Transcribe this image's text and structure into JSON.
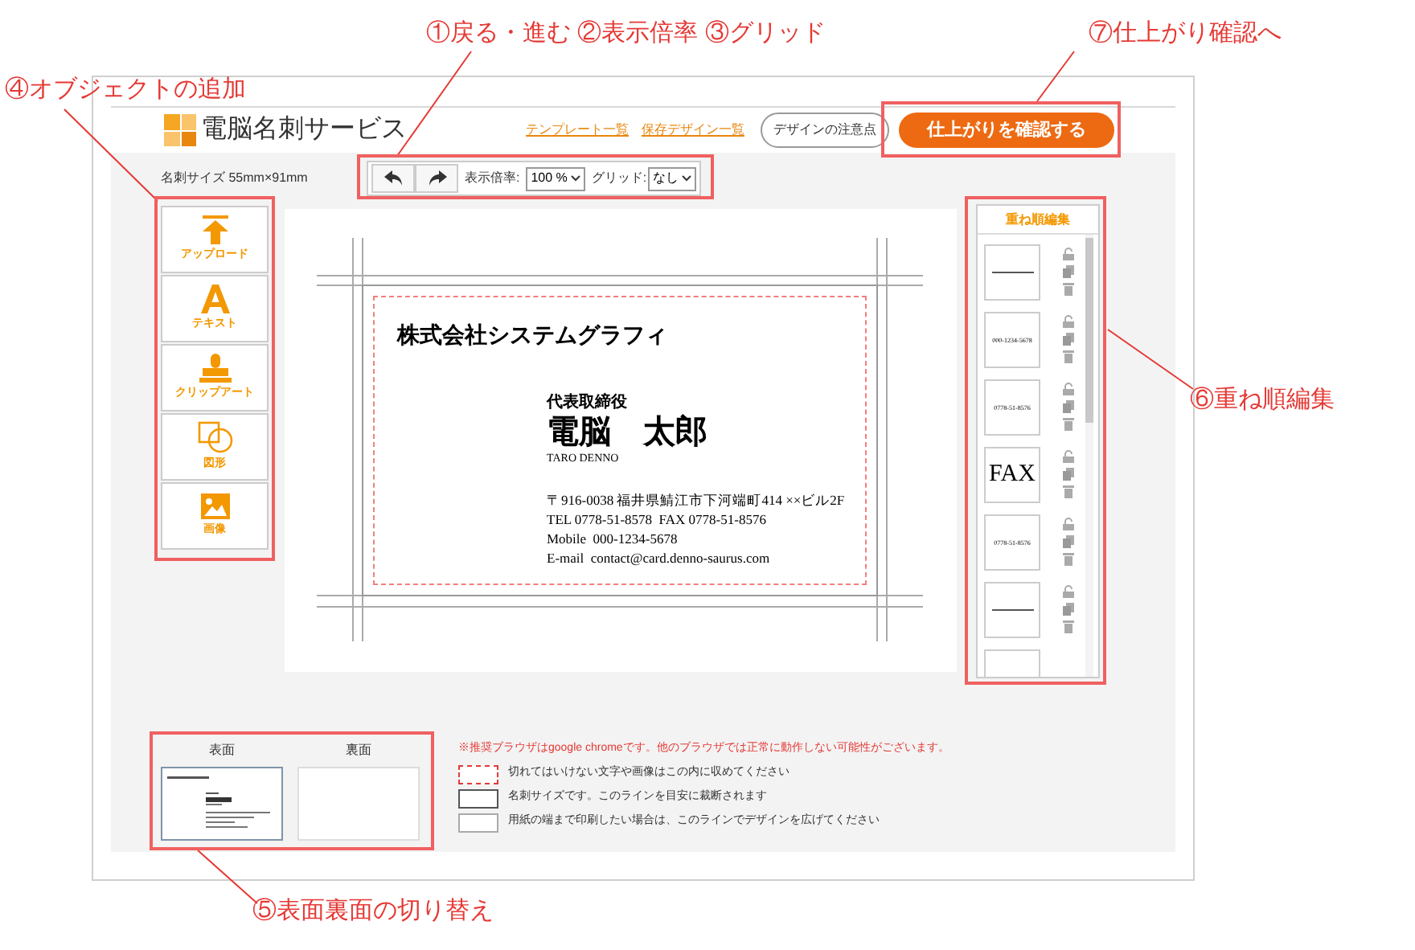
{
  "annotations": [
    {
      "label": "④オブジェクトの追加"
    },
    {
      "label": "①戻る・進む ②表示倍率 ③グリッド"
    },
    {
      "label": "⑦仕上がり確認へ"
    },
    {
      "label": "⑥重ね順編集"
    },
    {
      "label": "⑤表面裏面の切り替え"
    }
  ],
  "header": {
    "logo": "電脳名刺サービス",
    "links": [
      "テンプレート一覧",
      "保存デザイン一覧"
    ],
    "notice_button": "デザインの注意点",
    "finish_button": "仕上がりを確認する"
  },
  "toolbar": {
    "card_size": "名刺サイズ 55mm×91mm",
    "zoom_label": "表示倍率:",
    "zoom_value": "100 %",
    "grid_label": "グリッド:",
    "grid_value": "なし"
  },
  "tools": [
    {
      "kind": "upload",
      "label": "アップロード"
    },
    {
      "kind": "text",
      "label": "テキスト"
    },
    {
      "kind": "clipart",
      "label": "クリップアート"
    },
    {
      "kind": "shape",
      "label": "図形"
    },
    {
      "kind": "image",
      "label": "画像"
    }
  ],
  "card": {
    "company": "株式会社システムグラフィ",
    "title": "代表取締役",
    "name": "電脳　太郎",
    "romaji": "TARO DENNO",
    "lines": [
      "〒916-0038 福井県鯖江市下河端町414 ××ビル2F",
      "TEL 0778-51-8578  FAX 0778-51-8576",
      "Mobile  000-1234-5678",
      "E-mail  contact@card.denno-saurus.com"
    ]
  },
  "layers": {
    "title": "重ね順編集",
    "items": [
      {
        "kind": "line"
      },
      {
        "kind": "text",
        "text": "000-1234-5678"
      },
      {
        "kind": "text",
        "text": "0778-51-8576"
      },
      {
        "kind": "big",
        "text": "FAX"
      },
      {
        "kind": "text",
        "text": "0778-51-8576"
      },
      {
        "kind": "line"
      },
      {
        "kind": "cut"
      }
    ]
  },
  "sides": [
    {
      "label": "表面",
      "selected": true
    },
    {
      "label": "裏面",
      "selected": false
    }
  ],
  "notes": {
    "warning": "※推奨ブラウザはgoogle chromeです。他のブラウザでは正常に動作しない可能性がございます。",
    "legend": [
      {
        "kind": "dotted",
        "text": "切れてはいけない文字や画像はこの内に収めてください"
      },
      {
        "kind": "solid",
        "text": "名刺サイズです。このラインを目安に裁断されます"
      },
      {
        "kind": "light",
        "text": "用紙の端まで印刷したい場合は、このラインでデザインを広げてください"
      }
    ]
  }
}
